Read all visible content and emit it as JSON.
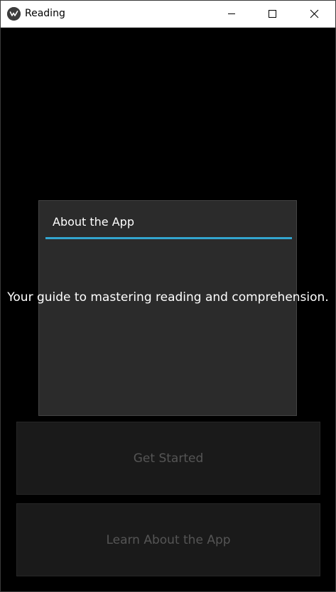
{
  "window": {
    "title": "Reading",
    "controls": {
      "minimize": "minimize-icon",
      "maximize": "maximize-icon",
      "close": "close-icon"
    }
  },
  "popup": {
    "title": "About the App",
    "content": "Your guide to mastering reading and comprehension.",
    "accent_color": "#33a5cf"
  },
  "buttons": {
    "get_started": "Get Started",
    "learn_about": "Learn About the App"
  },
  "colors": {
    "background": "#000000",
    "popup_background": "#2b2b2b",
    "button_background": "#1a1a1a",
    "button_text_disabled": "#555555"
  }
}
